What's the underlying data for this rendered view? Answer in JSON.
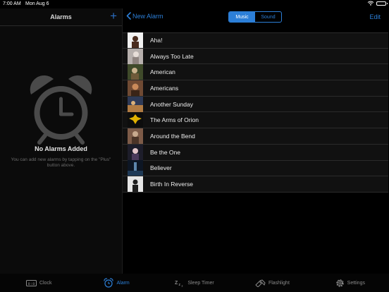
{
  "status_bar": {
    "time": "7:00 AM",
    "date": "Mon Aug 6"
  },
  "left_pane": {
    "title": "Alarms",
    "add_label": "+",
    "empty_title": "No Alarms Added",
    "empty_message": "You can add new alarms by tapping on the \"Plus\" button above."
  },
  "header": {
    "back_label": "New Alarm",
    "segments": [
      "Music",
      "Sound"
    ],
    "selected_segment": "Music",
    "edit_label": "Edit"
  },
  "songs": [
    {
      "title": "Aha!",
      "art_colors": [
        "#f2f2f2",
        "#4a2c1e"
      ]
    },
    {
      "title": "Always Too Late",
      "art_colors": [
        "#b7b0ad",
        "#e7ded8"
      ]
    },
    {
      "title": "American",
      "art_colors": [
        "#3f4a2a",
        "#c9b28e"
      ]
    },
    {
      "title": "Americans",
      "art_colors": [
        "#6f4a33",
        "#c98a5a"
      ]
    },
    {
      "title": "Another Sunday",
      "art_colors": [
        "#2e3a57",
        "#b07b43"
      ]
    },
    {
      "title": "The Arms of Orion",
      "art_colors": [
        "#0d0d0d",
        "#e0b000"
      ]
    },
    {
      "title": "Around the Bend",
      "art_colors": [
        "#7d5b48",
        "#c8a98e"
      ]
    },
    {
      "title": "Be the One",
      "art_colors": [
        "#1d1d2a",
        "#e3c6c9"
      ]
    },
    {
      "title": "Believer",
      "art_colors": [
        "#0d1624",
        "#5d86ad"
      ]
    },
    {
      "title": "Birth In Reverse",
      "art_colors": [
        "#e6e6e6",
        "#1c1c1c"
      ]
    }
  ],
  "tabs": [
    {
      "label": "Clock",
      "icon": "digital-clock-icon"
    },
    {
      "label": "Alarm",
      "icon": "alarm-clock-icon",
      "active": true
    },
    {
      "label": "Sleep Timer",
      "icon": "sleep-zzz-icon"
    },
    {
      "label": "Flashlight",
      "icon": "flashlight-icon"
    },
    {
      "label": "Settings",
      "icon": "gear-icon"
    }
  ],
  "colors": {
    "accent": "#2c7fd8",
    "background": "#000000",
    "row_bg": "#111111"
  }
}
